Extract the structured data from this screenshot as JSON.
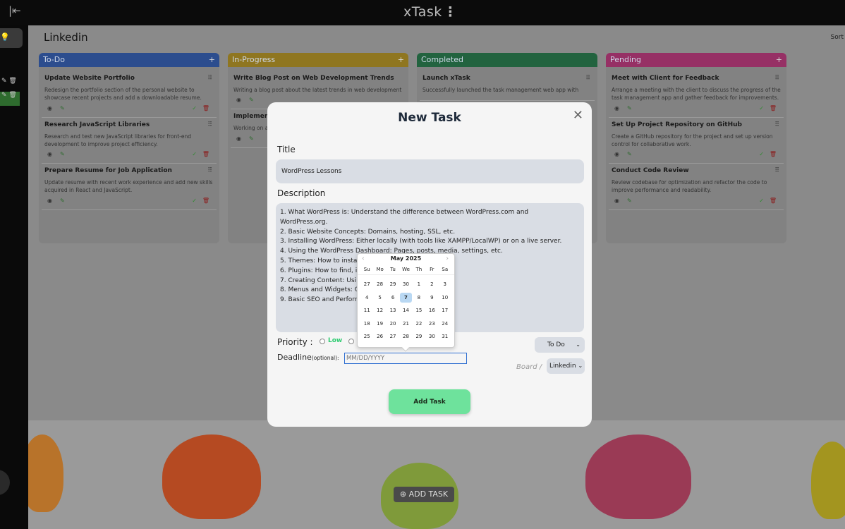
{
  "app": {
    "brand": "xTask",
    "brand_menu_icon": "kebab-icon"
  },
  "board": {
    "title": "Linkedin",
    "sort_label": "Sort"
  },
  "columns": [
    {
      "name": "To-Do",
      "color": "#3b6fd1",
      "cards": [
        {
          "title": "Update Website Portfolio",
          "desc": "Redesign the portfolio section of the personal website to showcase recent projects and add a downloadable resume."
        },
        {
          "title": "Research JavaScript Libraries",
          "desc": "Research and test new JavaScript libraries for front-end development to improve project efficiency."
        },
        {
          "title": "Prepare Resume for Job Application",
          "desc": "Update resume with recent work experience and add new skills acquired in React and JavaScript."
        }
      ]
    },
    {
      "name": "In-Progress",
      "color": "#c9a227",
      "cards": [
        {
          "title": "Write Blog Post on Web Development Trends",
          "desc": "Writing a blog post about the latest trends in web development"
        },
        {
          "title": "Implemen",
          "desc": "Working on and registra"
        }
      ]
    },
    {
      "name": "Completed",
      "color": "#2e8b57",
      "cards": [
        {
          "title": "Launch xTask",
          "desc": "Successfully launched the task management web app with"
        }
      ]
    },
    {
      "name": "Pending",
      "color": "#d23a8a",
      "cards": [
        {
          "title": "Meet with Client for Feedback",
          "desc": "Arrange a meeting with the client to discuss the progress of the task management app and gather feedback for improvements."
        },
        {
          "title": "Set Up Project Repository on GitHub",
          "desc": "Create a GitHub repository for the project and set up version control for collaborative work."
        },
        {
          "title": "Conduct Code Review",
          "desc": "Review codebase for optimization and refactor the code to improve performance and readability."
        }
      ]
    }
  ],
  "fab": {
    "label": "⊕ ADD TASK"
  },
  "modal": {
    "title": "New Task",
    "title_label": "Title",
    "title_value": "WordPress Lessons",
    "description_label": "Description",
    "description_lines": [
      "1. What WordPress is: Understand the difference between WordPress.com and",
      "WordPress.org.",
      "2. Basic Website Concepts: Domains, hosting, SSL, etc.",
      "3. Installing WordPress: Either locally (with tools like XAMPP/LocalWP) or on a live server.",
      "4. Using the WordPress Dashboard: Pages, posts, media, settings, etc.",
      "5. Themes: How to insta                                                   nes.",
      "6. Plugins: How to find, in",
      "7. Creating Content: Usi                                                   or or Classic Editor.",
      "8. Menus and Widgets: C                                                   sidebar/footer areas.",
      "9. Basic SEO and Perforn"
    ],
    "priority_label": "Priority :",
    "priority_low": "Low",
    "status_value": "To Do",
    "deadline_label": "Deadline",
    "deadline_optional": "(optional):",
    "deadline_placeholder": "MM/DD/YYYY",
    "board_label": "Board /",
    "board_value": "Linkedin",
    "submit_label": "Add Task"
  },
  "datepicker": {
    "month_label": "May 2025",
    "weekdays": [
      "Su",
      "Mo",
      "Tu",
      "We",
      "Th",
      "Fr",
      "Sa"
    ],
    "weeks": [
      [
        "27",
        "28",
        "29",
        "30",
        "1",
        "2",
        "3"
      ],
      [
        "4",
        "5",
        "6",
        "7",
        "8",
        "9",
        "10"
      ],
      [
        "11",
        "12",
        "13",
        "14",
        "15",
        "16",
        "17"
      ],
      [
        "18",
        "19",
        "20",
        "21",
        "22",
        "23",
        "24"
      ],
      [
        "25",
        "26",
        "27",
        "28",
        "29",
        "30",
        "31"
      ]
    ],
    "selected": "7"
  }
}
